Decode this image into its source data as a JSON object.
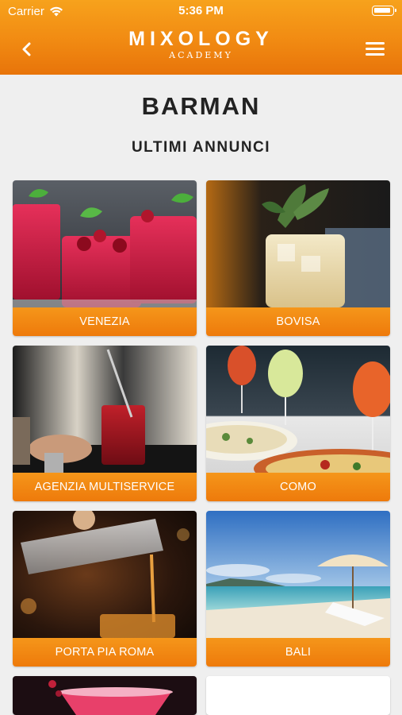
{
  "status": {
    "carrier": "Carrier",
    "time": "5:36 PM"
  },
  "header": {
    "logo_main": "MIXOLOGY",
    "logo_sub": "ACADEMY"
  },
  "page": {
    "title": "BARMAN",
    "subtitle": "ULTIMI ANNUNCI"
  },
  "cards": [
    {
      "label": "VENEZIA"
    },
    {
      "label": "BOVISA"
    },
    {
      "label": "AGENZIA MULTISERVICE"
    },
    {
      "label": "COMO"
    },
    {
      "label": "PORTA PIA ROMA"
    },
    {
      "label": "BALI"
    }
  ],
  "colors": {
    "accent": "#f18a12",
    "background": "#efefef"
  }
}
